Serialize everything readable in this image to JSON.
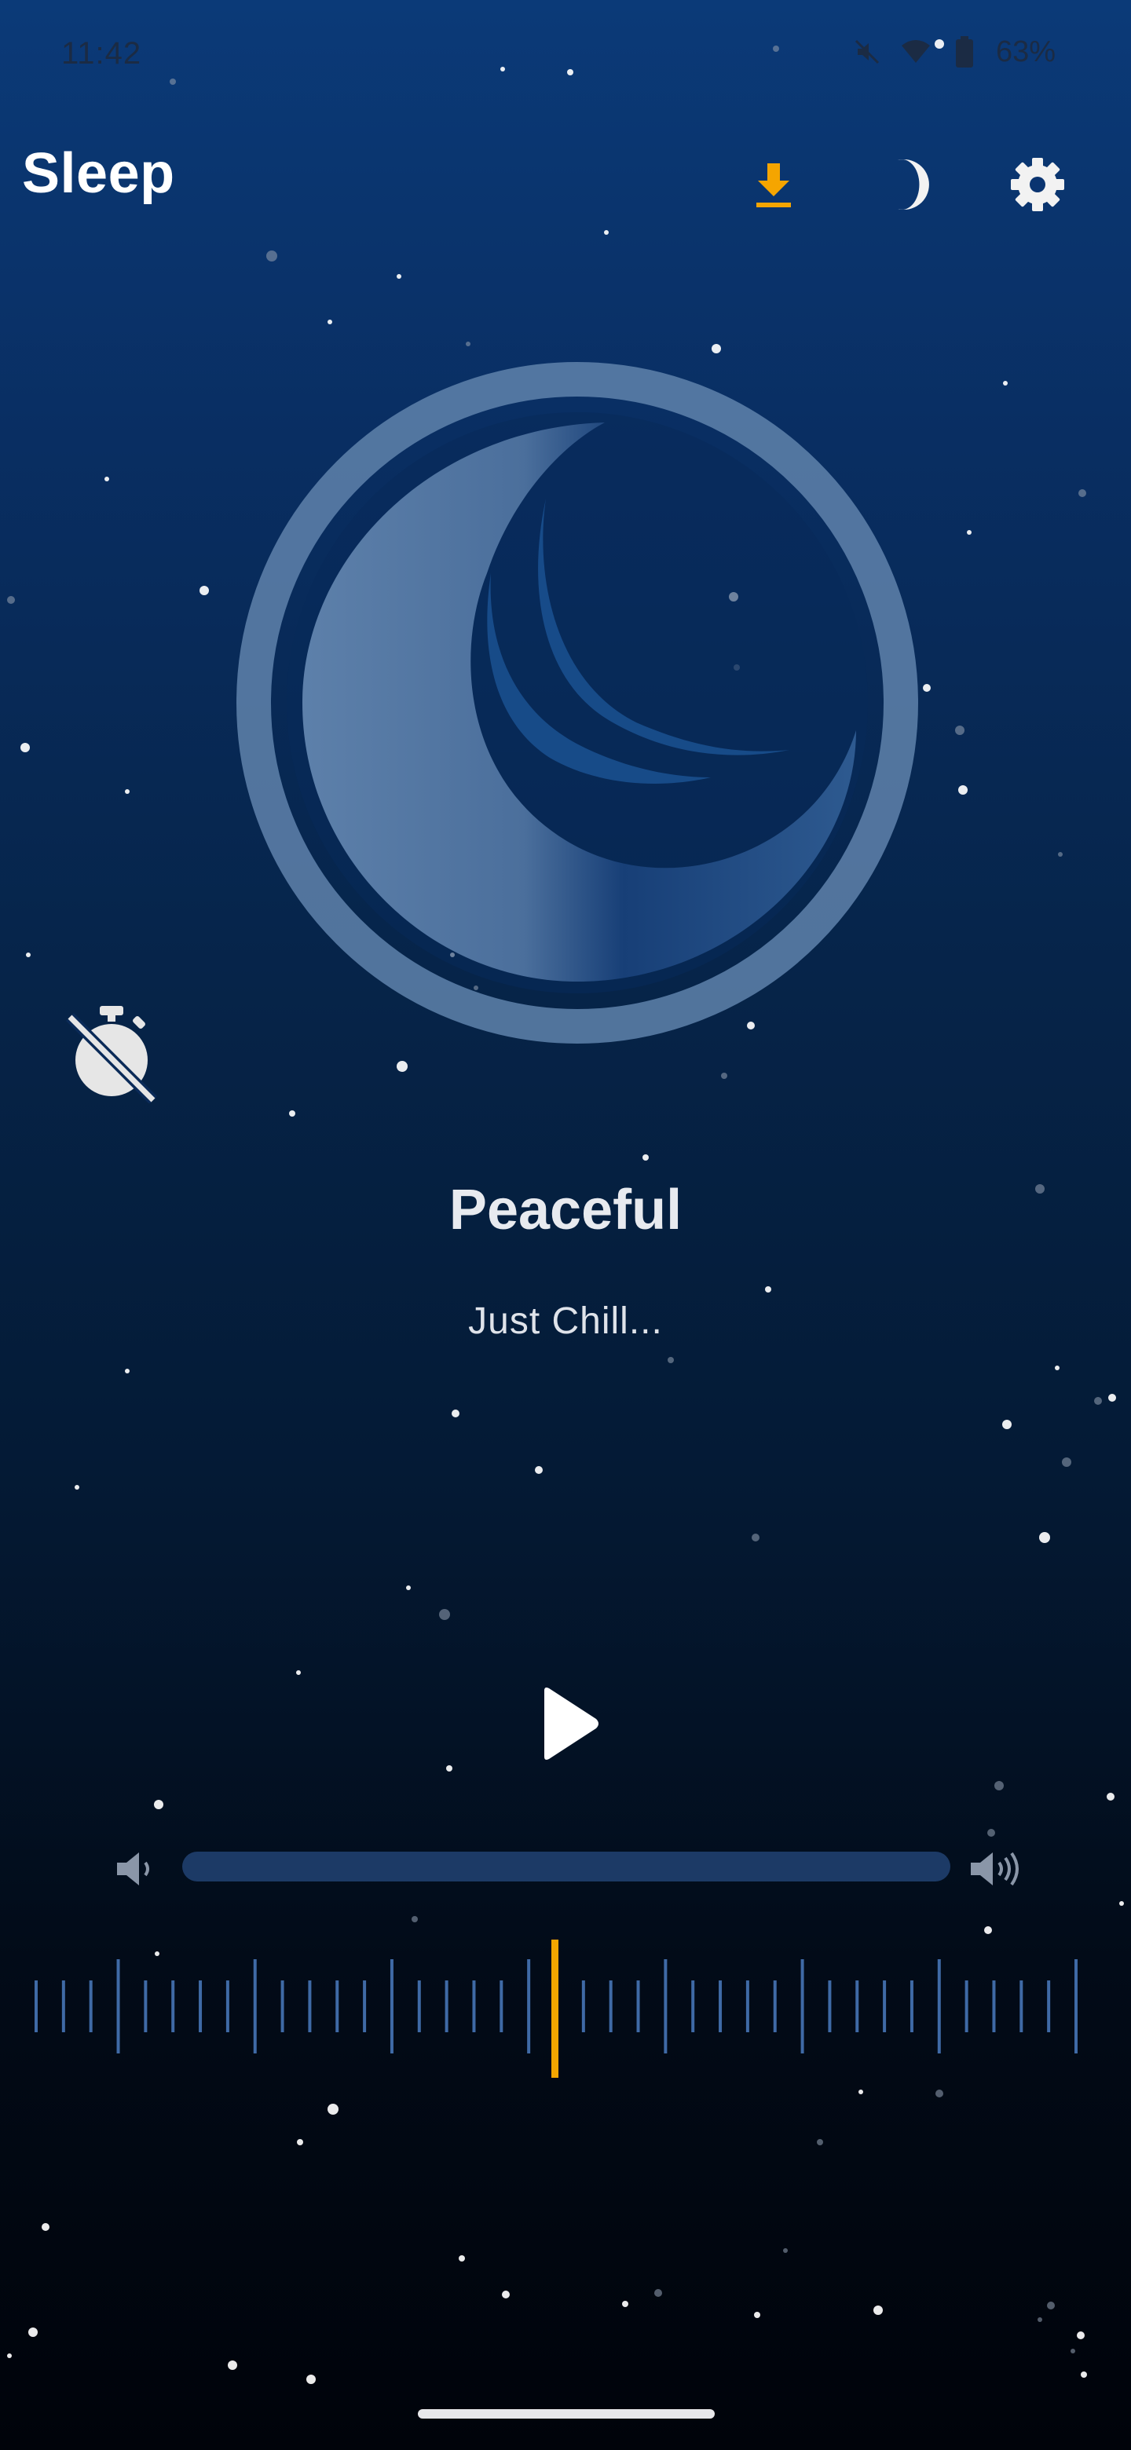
{
  "status_bar": {
    "time": "11:42",
    "battery": "63%",
    "icons": [
      "mute-icon",
      "wifi-icon",
      "battery-icon"
    ]
  },
  "app_bar": {
    "title": "Sleep",
    "actions": [
      "download-icon",
      "moon-icon",
      "gear-icon"
    ],
    "download_color": "#f5a500"
  },
  "track": {
    "title": "Peaceful",
    "subtitle": "Just Chill..."
  },
  "controls": {
    "timer_icon": "timer-off-icon",
    "play_icon": "play-icon",
    "volume_low_icon": "volume-low-icon",
    "volume_high_icon": "volume-high-icon"
  },
  "tuner": {
    "accent": "#f5a500",
    "selected_position": 0.5
  }
}
